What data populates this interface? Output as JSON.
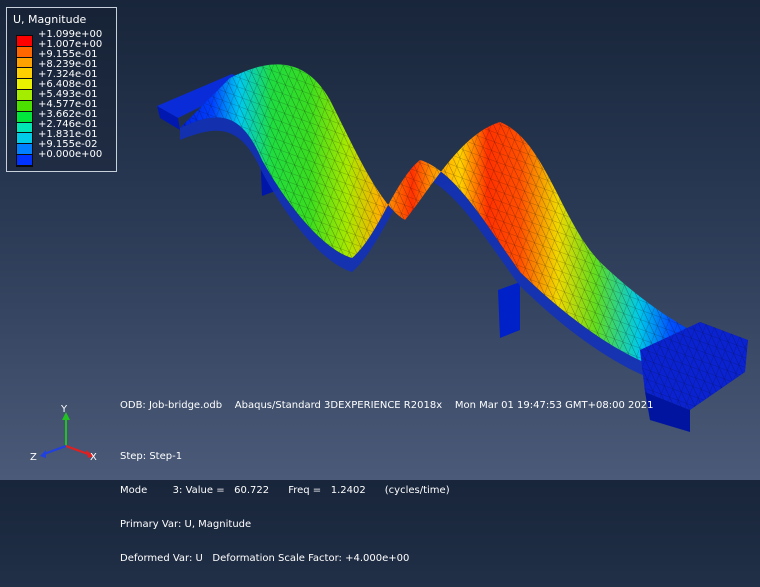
{
  "legend": {
    "title": "U, Magnitude",
    "levels": [
      "+1.099e+00",
      "+1.007e+00",
      "+9.155e-01",
      "+8.239e-01",
      "+7.324e-01",
      "+6.408e-01",
      "+5.493e-01",
      "+4.577e-01",
      "+3.662e-01",
      "+2.746e-01",
      "+1.831e-01",
      "+9.155e-02",
      "+0.000e+00"
    ],
    "colors": [
      "#ff0000",
      "#ff6600",
      "#ffa200",
      "#ffd000",
      "#eaf200",
      "#a4ec00",
      "#4ce000",
      "#00e63c",
      "#00e6b4",
      "#00cce8",
      "#0080ff",
      "#0033ff",
      "#0000d8"
    ]
  },
  "info": {
    "odb_line": "ODB: Job-bridge.odb    Abaqus/Standard 3DEXPERIENCE R2018x    Mon Mar 01 19:47:53 GMT+08:00 2021",
    "step": "Step: Step-1",
    "mode": "Mode        3: Value =   60.722      Freq =   1.2402      (cycles/time)",
    "primary_var": "Primary Var: U, Magnitude",
    "deformed_var": "Deformed Var: U   Deformation Scale Factor: +4.000e+00"
  },
  "triad": {
    "x_label": "X",
    "y_label": "Y",
    "z_label": "Z"
  }
}
